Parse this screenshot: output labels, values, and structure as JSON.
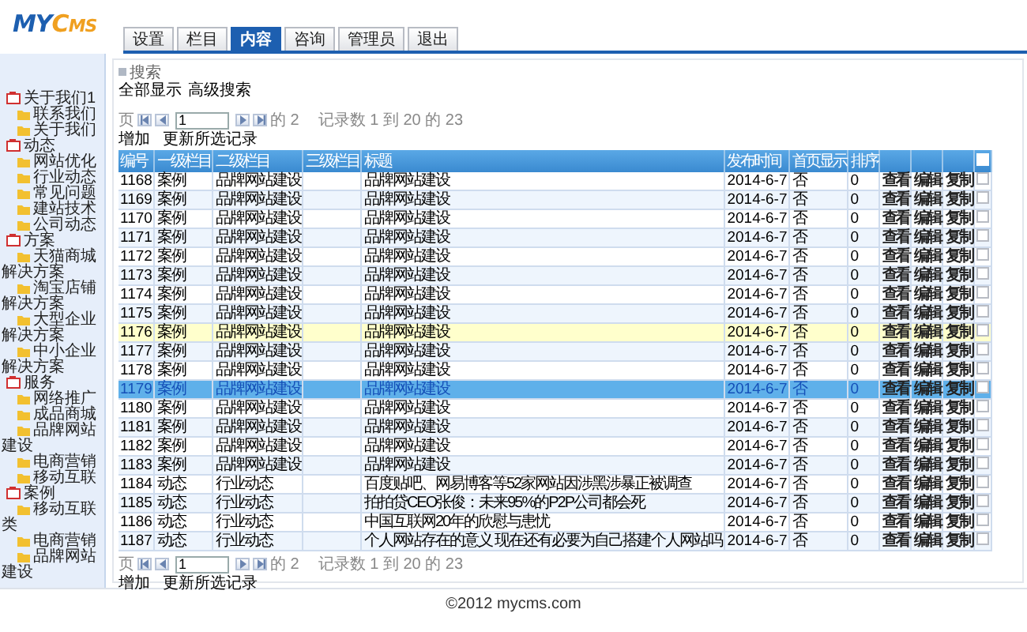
{
  "logo": {
    "lead": "MY",
    "rest": "CMS"
  },
  "tabs": [
    {
      "label": "设置",
      "selected": false
    },
    {
      "label": "栏目",
      "selected": false
    },
    {
      "label": "内容",
      "selected": true
    },
    {
      "label": "咨询",
      "selected": false
    },
    {
      "label": "管理员",
      "selected": false
    },
    {
      "label": "退出",
      "selected": false
    }
  ],
  "sidebar": {
    "items": [
      {
        "label": "关于我们1",
        "children": [
          {
            "label": "联系我们"
          },
          {
            "label": "关于我们"
          }
        ]
      },
      {
        "label": "动态",
        "children": [
          {
            "label": "网站优化"
          },
          {
            "label": "行业动态"
          },
          {
            "label": "常见问题"
          },
          {
            "label": "建站技术"
          },
          {
            "label": "公司动态"
          }
        ]
      },
      {
        "label": "方案",
        "children": [
          {
            "label": "天猫商城解决方案"
          },
          {
            "label": "淘宝店铺解决方案"
          },
          {
            "label": "大型企业解决方案"
          },
          {
            "label": "中小企业解决方案"
          }
        ]
      },
      {
        "label": "服务",
        "children": [
          {
            "label": "网络推广"
          },
          {
            "label": "成品商城"
          },
          {
            "label": "品牌网站建设"
          },
          {
            "label": "电商营销"
          },
          {
            "label": "移动互联"
          }
        ]
      },
      {
        "label": "案例",
        "children": [
          {
            "label": "移动互联类"
          },
          {
            "label": "电商营销"
          },
          {
            "label": "品牌网站建设"
          }
        ]
      }
    ]
  },
  "search": {
    "title": "搜索",
    "links": [
      "全部显示",
      "高级搜索"
    ]
  },
  "pagers": [
    {
      "page_label": "页",
      "page": "1",
      "of": "的 2",
      "records": "记录数 1 到 20 的 23",
      "actions": [
        "增加",
        "更新所选记录"
      ]
    },
    {
      "page_label": "页",
      "page": "1",
      "of": "的 2",
      "records": "记录数 1 到 20 的 23",
      "actions": [
        "增加",
        "更新所选记录"
      ]
    }
  ],
  "table": {
    "columns": [
      "编号",
      "一级栏目",
      "二级栏目",
      "三级栏目",
      "标题",
      "发布时间",
      "首页显示",
      "排序"
    ],
    "select_all_checked": false,
    "rows": [
      {
        "id": "1168",
        "level1": "案例",
        "level2": "品牌网站建设",
        "title": "品牌网站建设",
        "date": "2014-6-7",
        "homepage": "否",
        "order": "0",
        "actions": [
          "查看",
          "编辑",
          "复制"
        ],
        "checked": false,
        "selected": false,
        "highlighted": false
      },
      {
        "id": "1169",
        "level1": "案例",
        "level2": "品牌网站建设",
        "title": "品牌网站建设",
        "date": "2014-6-7",
        "homepage": "否",
        "order": "0",
        "actions": [
          "查看",
          "编辑",
          "复制"
        ],
        "checked": false,
        "selected": false,
        "highlighted": false
      },
      {
        "id": "1170",
        "level1": "案例",
        "level2": "品牌网站建设",
        "title": "品牌网站建设",
        "date": "2014-6-7",
        "homepage": "否",
        "order": "0",
        "actions": [
          "查看",
          "编辑",
          "复制"
        ],
        "checked": false,
        "selected": false,
        "highlighted": false
      },
      {
        "id": "1171",
        "level1": "案例",
        "level2": "品牌网站建设",
        "title": "品牌网站建设",
        "date": "2014-6-7",
        "homepage": "否",
        "order": "0",
        "actions": [
          "查看",
          "编辑",
          "复制"
        ],
        "checked": false,
        "selected": false,
        "highlighted": false
      },
      {
        "id": "1172",
        "level1": "案例",
        "level2": "品牌网站建设",
        "title": "品牌网站建设",
        "date": "2014-6-7",
        "homepage": "否",
        "order": "0",
        "actions": [
          "查看",
          "编辑",
          "复制"
        ],
        "checked": false,
        "selected": false,
        "highlighted": false
      },
      {
        "id": "1173",
        "level1": "案例",
        "level2": "品牌网站建设",
        "title": "品牌网站建设",
        "date": "2014-6-7",
        "homepage": "否",
        "order": "0",
        "actions": [
          "查看",
          "编辑",
          "复制"
        ],
        "checked": false,
        "selected": false,
        "highlighted": false
      },
      {
        "id": "1174",
        "level1": "案例",
        "level2": "品牌网站建设",
        "title": "品牌网站建设",
        "date": "2014-6-7",
        "homepage": "否",
        "order": "0",
        "actions": [
          "查看",
          "编辑",
          "复制"
        ],
        "checked": false,
        "selected": false,
        "highlighted": false
      },
      {
        "id": "1175",
        "level1": "案例",
        "level2": "品牌网站建设",
        "title": "品牌网站建设",
        "date": "2014-6-7",
        "homepage": "否",
        "order": "0",
        "actions": [
          "查看",
          "编辑",
          "复制"
        ],
        "checked": false,
        "selected": false,
        "highlighted": false
      },
      {
        "id": "1176",
        "level1": "案例",
        "level2": "品牌网站建设",
        "title": "品牌网站建设",
        "date": "2014-6-7",
        "homepage": "否",
        "order": "0",
        "actions": [
          "查看",
          "编辑",
          "复制"
        ],
        "checked": false,
        "selected": false,
        "highlighted": true
      },
      {
        "id": "1177",
        "level1": "案例",
        "level2": "品牌网站建设",
        "title": "品牌网站建设",
        "date": "2014-6-7",
        "homepage": "否",
        "order": "0",
        "actions": [
          "查看",
          "编辑",
          "复制"
        ],
        "checked": false,
        "selected": false,
        "highlighted": false
      },
      {
        "id": "1178",
        "level1": "案例",
        "level2": "品牌网站建设",
        "title": "品牌网站建设",
        "date": "2014-6-7",
        "homepage": "否",
        "order": "0",
        "actions": [
          "查看",
          "编辑",
          "复制"
        ],
        "checked": false,
        "selected": false,
        "highlighted": false
      },
      {
        "id": "1179",
        "level1": "案例",
        "level2": "品牌网站建设",
        "title": "品牌网站建设",
        "date": "2014-6-7",
        "homepage": "否",
        "order": "0",
        "actions": [
          "查看",
          "编辑",
          "复制"
        ],
        "checked": false,
        "selected": true,
        "highlighted": false
      },
      {
        "id": "1180",
        "level1": "案例",
        "level2": "品牌网站建设",
        "title": "品牌网站建设",
        "date": "2014-6-7",
        "homepage": "否",
        "order": "0",
        "actions": [
          "查看",
          "编辑",
          "复制"
        ],
        "checked": false,
        "selected": false,
        "highlighted": false
      },
      {
        "id": "1181",
        "level1": "案例",
        "level2": "品牌网站建设",
        "title": "品牌网站建设",
        "date": "2014-6-7",
        "homepage": "否",
        "order": "0",
        "actions": [
          "查看",
          "编辑",
          "复制"
        ],
        "checked": false,
        "selected": false,
        "highlighted": false
      },
      {
        "id": "1182",
        "level1": "案例",
        "level2": "品牌网站建设",
        "title": "品牌网站建设",
        "date": "2014-6-7",
        "homepage": "否",
        "order": "0",
        "actions": [
          "查看",
          "编辑",
          "复制"
        ],
        "checked": false,
        "selected": false,
        "highlighted": false
      },
      {
        "id": "1183",
        "level1": "案例",
        "level2": "品牌网站建设",
        "title": "品牌网站建设",
        "date": "2014-6-7",
        "homepage": "否",
        "order": "0",
        "actions": [
          "查看",
          "编辑",
          "复制"
        ],
        "checked": false,
        "selected": false,
        "highlighted": false
      },
      {
        "id": "1184",
        "level1": "动态",
        "level2": "行业动态",
        "title": "百度贴吧、网易博客等52家网站因涉黑涉暴正被调查",
        "date": "2014-6-7",
        "homepage": "否",
        "order": "0",
        "actions": [
          "查看",
          "编辑",
          "复制"
        ],
        "checked": false,
        "selected": false,
        "highlighted": false
      },
      {
        "id": "1185",
        "level1": "动态",
        "level2": "行业动态",
        "title": "拍拍贷CEO张俊：未来95%的P2P公司都会死",
        "date": "2014-6-7",
        "homepage": "否",
        "order": "0",
        "actions": [
          "查看",
          "编辑",
          "复制"
        ],
        "checked": false,
        "selected": false,
        "highlighted": false
      },
      {
        "id": "1186",
        "level1": "动态",
        "level2": "行业动态",
        "title": "中国互联网20年的欣慰与患忧",
        "date": "2014-6-7",
        "homepage": "否",
        "order": "0",
        "actions": [
          "查看",
          "编辑",
          "复制"
        ],
        "checked": false,
        "selected": false,
        "highlighted": false
      },
      {
        "id": "1187",
        "level1": "动态",
        "level2": "行业动态",
        "title": "个人网站存在的意义 现在还有必要为自己搭建个人网站吗",
        "date": "2014-6-7",
        "homepage": "否",
        "order": "0",
        "actions": [
          "查看",
          "编辑",
          "复制"
        ],
        "checked": false,
        "selected": false,
        "highlighted": false
      }
    ]
  },
  "footer": "©2012 mycms.com"
}
